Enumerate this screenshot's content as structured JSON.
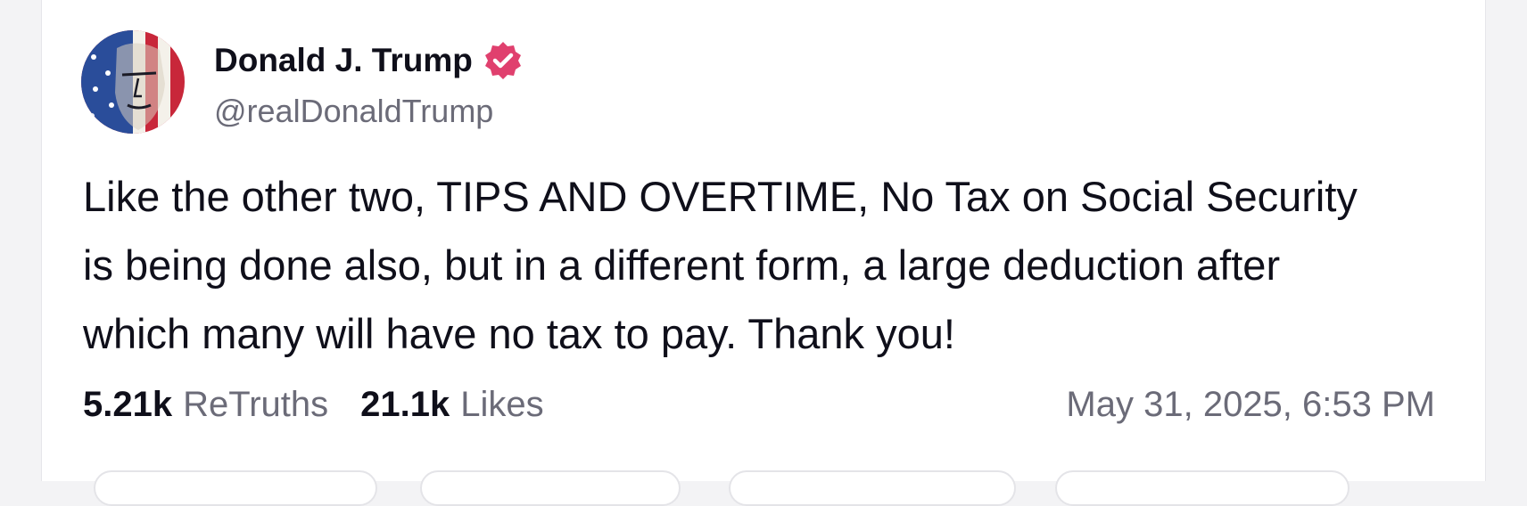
{
  "post": {
    "author": {
      "display_name": "Donald J. Trump",
      "handle": "@realDonaldTrump",
      "verified": true,
      "avatar_icon": "avatar-flag-portrait-icon"
    },
    "text_lines": [
      "Like the other two, TIPS AND OVERTIME, No Tax on Social Security",
      "is being done also, but in a different form, a large deduction after",
      "which many will have no tax to pay. Thank you!"
    ],
    "stats": {
      "retruths_count": "5.21k",
      "retruths_label": "ReTruths",
      "likes_count": "21.1k",
      "likes_label": "Likes"
    },
    "timestamp": "May 31, 2025, 6:53 PM"
  },
  "colors": {
    "verified_badge": "#e0406e",
    "text_primary": "#0f0f1a",
    "text_secondary": "#6b6b78"
  }
}
